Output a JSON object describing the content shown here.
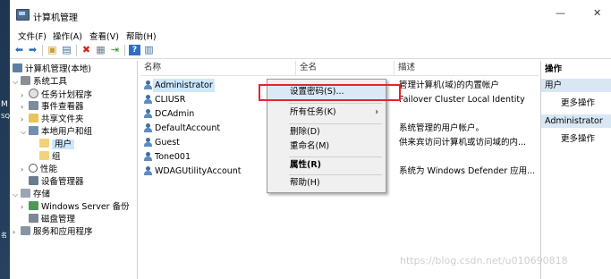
{
  "desktop": {
    "chars": [
      "M",
      "SQ",
      "名"
    ]
  },
  "window": {
    "title": "计算机管理",
    "minimize": "—",
    "close": "✕"
  },
  "menubar": [
    "文件(F)",
    "操作(A)",
    "查看(V)",
    "帮助(H)"
  ],
  "toolbar": {
    "icons": [
      "back-icon",
      "forward-icon",
      "up-folder-icon",
      "console-tree-icon",
      "delete-icon",
      "properties-icon",
      "export-icon",
      "help-icon",
      "view-icon"
    ]
  },
  "tree": {
    "root": "计算机管理(本地)",
    "system_tools": "系统工具",
    "task_scheduler": "任务计划程序",
    "event_viewer": "事件查看器",
    "shared_folders": "共享文件夹",
    "local_users": "本地用户和组",
    "users": "用户",
    "groups": "组",
    "performance": "性能",
    "device_manager": "设备管理器",
    "storage": "存储",
    "windows_backup": "Windows Server 备份",
    "disk_management": "磁盘管理",
    "services_apps": "服务和应用程序"
  },
  "columns": {
    "name": "名称",
    "fullname": "全名",
    "description": "描述"
  },
  "users": [
    {
      "name": "Administrator",
      "description": "管理计算机(域)的内置帐户"
    },
    {
      "name": "CLIUSR",
      "description": "Failover Cluster Local Identity"
    },
    {
      "name": "DCAdmin",
      "description": ""
    },
    {
      "name": "DefaultAccount",
      "description": "系统管理的用户帐户。"
    },
    {
      "name": "Guest",
      "description": "供来宾访问计算机或访问域的内..."
    },
    {
      "name": "Tone001",
      "description": ""
    },
    {
      "name": "WDAGUtilityAccount",
      "description": "系统为 Windows Defender 应用..."
    }
  ],
  "context_menu": {
    "set_password": "设置密码(S)...",
    "all_tasks": "所有任务(K)",
    "all_tasks_arrow": "›",
    "delete": "删除(D)",
    "rename": "重命名(M)",
    "properties": "属性(R)",
    "help": "帮助(H)"
  },
  "actions": {
    "header": "操作",
    "section1": "用户",
    "more1": "更多操作",
    "section2": "Administrator",
    "more2": "更多操作"
  },
  "watermark": "https://blog.csdn.net/u010690818",
  "colors": {
    "selection": "#cce8ff",
    "action_header": "#d9e7f4",
    "highlight_box": "#e0262e"
  }
}
